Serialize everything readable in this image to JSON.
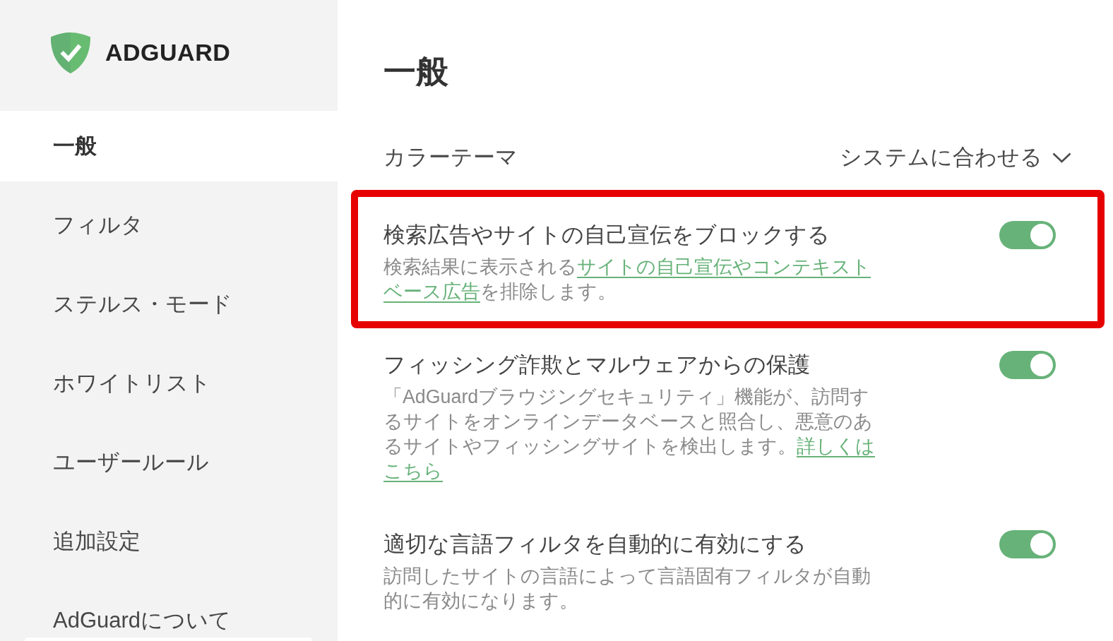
{
  "sidebar": {
    "logo": "ADGUARD",
    "items": [
      {
        "label": "一般",
        "selected": true
      },
      {
        "label": "フィルタ",
        "selected": false
      },
      {
        "label": "ステルス・モード",
        "selected": false
      },
      {
        "label": "ホワイトリスト",
        "selected": false
      },
      {
        "label": "ユーザールール",
        "selected": false
      },
      {
        "label": "追加設定",
        "selected": false
      },
      {
        "label": "AdGuardについて",
        "selected": false
      }
    ]
  },
  "page": {
    "title": "一般"
  },
  "color_theme": {
    "label": "カラーテーマ",
    "value": "システムに合わせる"
  },
  "settings": [
    {
      "title": "検索広告やサイトの自己宣伝をブロックする",
      "description": [
        {
          "kind": "text",
          "text": "検索結果に表示される"
        },
        {
          "kind": "link",
          "text": "サイトの自己宣伝やコンテキスト"
        },
        {
          "kind": "link",
          "text": "ベース広告"
        },
        {
          "kind": "text",
          "text": "を排除します。"
        }
      ],
      "on": true,
      "highlighted": true
    },
    {
      "title": "フィッシング詐欺とマルウェアからの保護",
      "description": [
        {
          "kind": "text",
          "text": "「AdGuardブラウジングセキュリティ」機能が、訪問するサイトをオンラインデータベースと照合し、悪意のあるサイトやフィッシングサイトを検出します。"
        },
        {
          "kind": "link",
          "text": "詳しくは"
        },
        {
          "kind": "link",
          "text": "こちら"
        }
      ],
      "on": true,
      "highlighted": false
    },
    {
      "title": "適切な言語フィルタを自動的に有効にする",
      "description": [
        {
          "kind": "text",
          "text": "訪問したサイトの言語によって言語固有フィルタが自動的に有効になります。"
        }
      ],
      "on": true,
      "highlighted": false
    }
  ]
}
